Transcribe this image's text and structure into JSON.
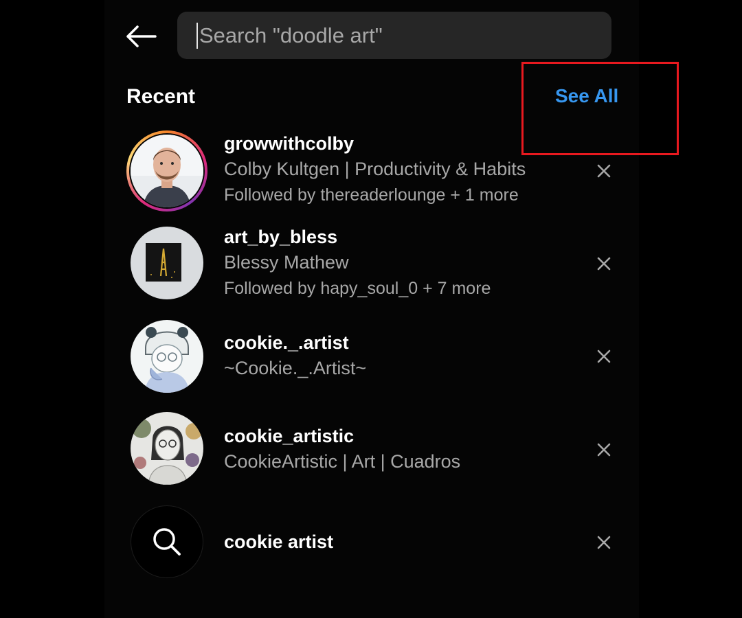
{
  "search": {
    "placeholder": "Search \"doodle art\""
  },
  "recent": {
    "title": "Recent",
    "see_all_label": "See All"
  },
  "items": [
    {
      "username": "growwithcolby",
      "fullname": "Colby Kultgen | Productivity & Habits",
      "followed_by": "Followed by thereaderlounge + 1 more"
    },
    {
      "username": "art_by_bless",
      "fullname": "Blessy Mathew",
      "followed_by": "Followed by hapy_soul_0 + 7 more"
    },
    {
      "username": "cookie._.artist",
      "fullname": "~Cookie._.Artist~"
    },
    {
      "username": "cookie_artistic",
      "fullname": "CookieArtistic | Art | Cuadros"
    },
    {
      "query": "cookie artist"
    }
  ],
  "colors": {
    "background": "#000000",
    "search_bg": "#262626",
    "link_blue": "#3797f0",
    "secondary_text": "#a8a8a8",
    "highlight_red": "#e8191f"
  },
  "icons": {
    "back": "arrow-left-icon",
    "remove": "close-icon",
    "search": "search-icon"
  }
}
